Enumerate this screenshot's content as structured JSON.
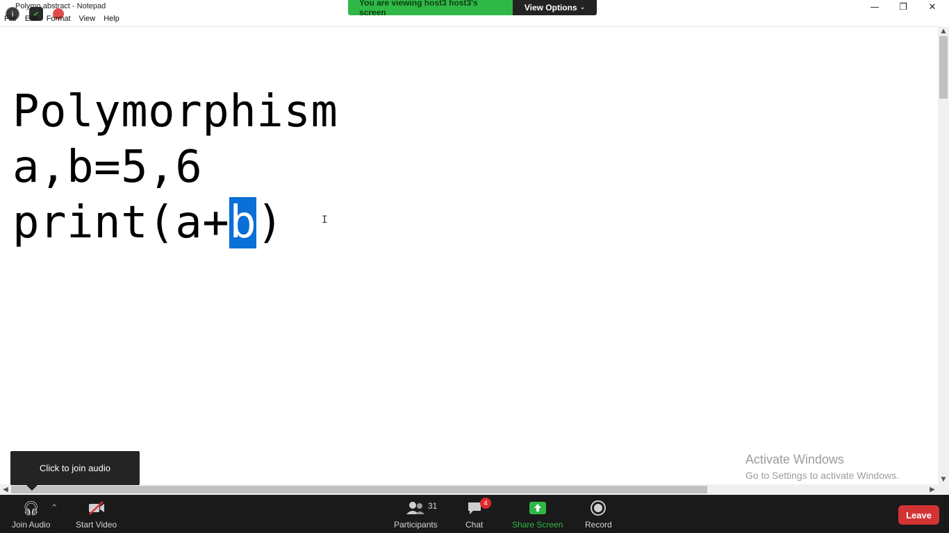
{
  "window": {
    "title": "Polymo abstract - Notepad",
    "minimize_glyph": "—",
    "maximize_glyph": "❐",
    "close_glyph": "✕"
  },
  "menu": [
    "File",
    "Edit",
    "Format",
    "View",
    "Help"
  ],
  "banner": {
    "viewing": "You are viewing host3 host3's screen",
    "view_options": "View Options"
  },
  "editor": {
    "line1": "Polymorphism",
    "line2": "a,b=5,6",
    "line3_before": "print(a+",
    "line3_selected": "b",
    "line3_after": ")"
  },
  "watermark": {
    "title": "Activate Windows",
    "subtitle": "Go to Settings to activate Windows."
  },
  "tooltip": "Click to join audio",
  "toolbar": {
    "join_audio": "Join Audio",
    "start_video": "Start Video",
    "participants": "Participants",
    "participants_count": "31",
    "chat": "Chat",
    "chat_badge": "4",
    "share_screen": "Share Screen",
    "record": "Record",
    "leave": "Leave"
  },
  "colors": {
    "banner_green": "#2fb847",
    "selection_blue": "#0a6fd6",
    "leave_red": "#d33333",
    "toolbar_bg": "#1a1a1a"
  }
}
